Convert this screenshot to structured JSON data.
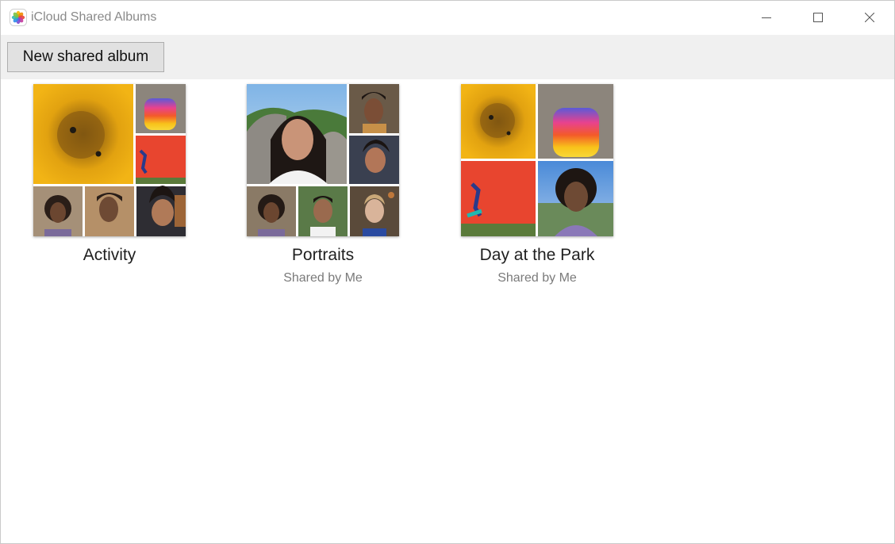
{
  "window": {
    "title": "iCloud Shared Albums",
    "controls": [
      "minimize",
      "maximize",
      "close"
    ]
  },
  "toolbar": {
    "new_album_label": "New shared album"
  },
  "albums": [
    {
      "name": "Activity",
      "subtitle": ""
    },
    {
      "name": "Portraits",
      "subtitle": "Shared by Me"
    },
    {
      "name": "Day at the Park",
      "subtitle": "Shared by Me"
    }
  ],
  "colors": {
    "toolbar_bg": "#f0f0f0",
    "button_bg": "#e1e1e1",
    "title_text": "#8a8a8a",
    "subtitle_text": "#7a7a7a"
  },
  "icons": [
    "photos-app-icon",
    "minimize-icon",
    "maximize-icon",
    "close-icon"
  ]
}
